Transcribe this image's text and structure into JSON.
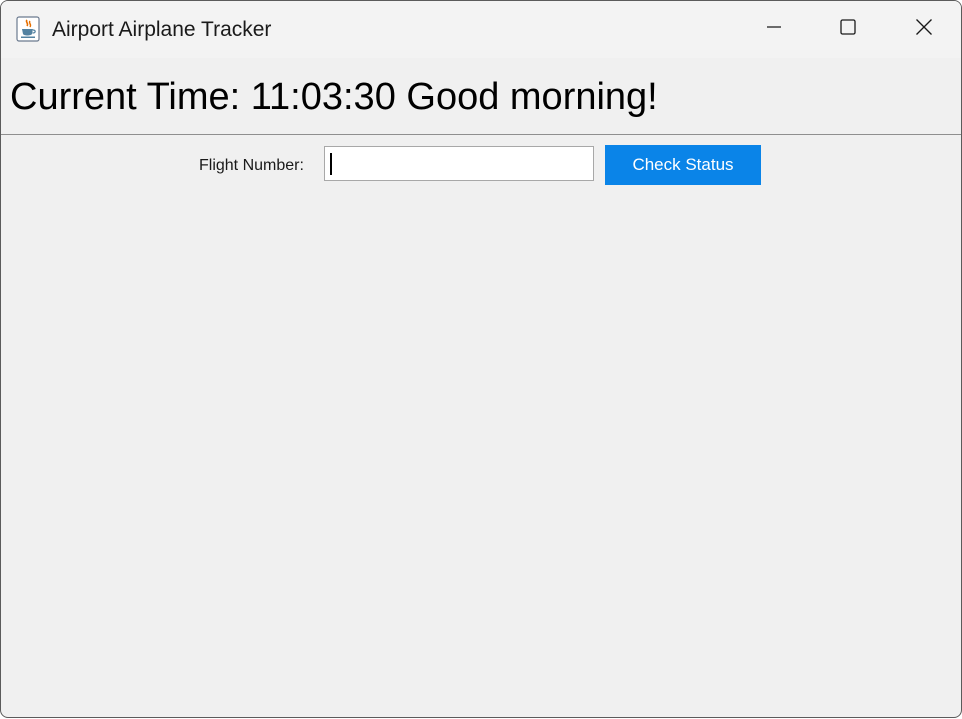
{
  "window": {
    "title": "Airport Airplane Tracker",
    "icon": "java-coffee-cup-icon",
    "controls": {
      "minimize_icon": "minimize-icon",
      "maximize_icon": "maximize-icon",
      "close_icon": "close-icon"
    }
  },
  "header": {
    "greeting": "Current Time: 11:03:30 Good morning!"
  },
  "form": {
    "flight_label": "Flight Number:",
    "flight_value": "",
    "check_button_label": "Check Status"
  },
  "colors": {
    "accent": "#0a84e8",
    "window_bg": "#f0f0f0",
    "titlebar_bg": "#f3f3f3"
  }
}
